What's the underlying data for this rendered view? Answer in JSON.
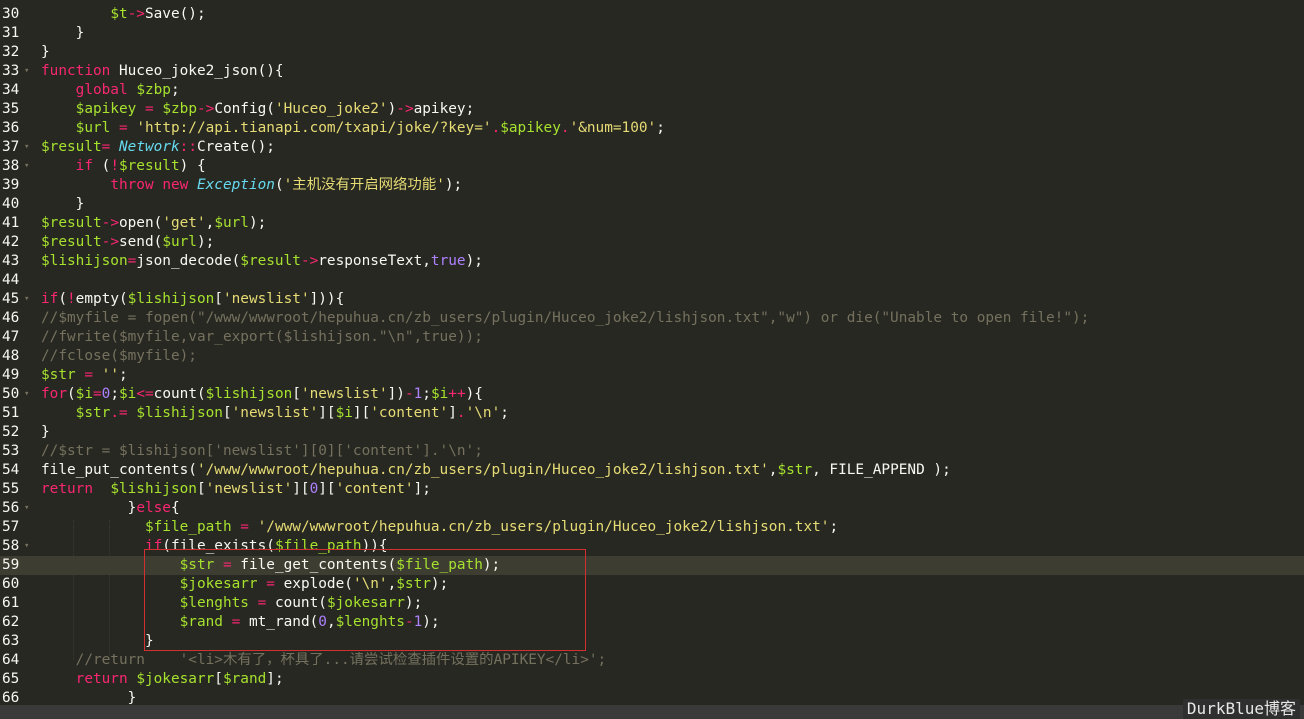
{
  "editor": {
    "theme": "Monokai",
    "colors": {
      "background": "#272822",
      "keyword": "#f92672",
      "variable": "#a6e22e",
      "string": "#e6db74",
      "comment": "#75715e",
      "class": "#66d9ef",
      "constant": "#ae81ff",
      "highlight_box": "#d03030"
    },
    "lines": [
      {
        "n": "30",
        "fold": false,
        "tokens": [
          [
            "p",
            "        "
          ],
          [
            "v",
            "$t"
          ],
          [
            "k",
            "->"
          ],
          [
            "f",
            "Save();"
          ]
        ]
      },
      {
        "n": "31",
        "fold": false,
        "tokens": [
          [
            "p",
            "    }"
          ]
        ]
      },
      {
        "n": "32",
        "fold": false,
        "tokens": [
          [
            "p",
            "}"
          ]
        ]
      },
      {
        "n": "33",
        "fold": true,
        "tokens": [
          [
            "k",
            "function"
          ],
          [
            "p",
            " Huceo_joke2_json(){"
          ]
        ]
      },
      {
        "n": "34",
        "fold": false,
        "tokens": [
          [
            "p",
            "    "
          ],
          [
            "k",
            "global"
          ],
          [
            "p",
            " "
          ],
          [
            "v",
            "$zbp"
          ],
          [
            "p",
            ";"
          ]
        ]
      },
      {
        "n": "35",
        "fold": false,
        "tokens": [
          [
            "p",
            "    "
          ],
          [
            "v",
            "$apikey"
          ],
          [
            "p",
            " "
          ],
          [
            "k",
            "="
          ],
          [
            "p",
            " "
          ],
          [
            "v",
            "$zbp"
          ],
          [
            "k",
            "->"
          ],
          [
            "p",
            "Config("
          ],
          [
            "s",
            "'Huceo_joke2'"
          ],
          [
            "p",
            ")"
          ],
          [
            "k",
            "->"
          ],
          [
            "p",
            "apikey;"
          ]
        ]
      },
      {
        "n": "36",
        "fold": false,
        "tokens": [
          [
            "p",
            "    "
          ],
          [
            "v",
            "$url"
          ],
          [
            "p",
            " "
          ],
          [
            "k",
            "="
          ],
          [
            "p",
            " "
          ],
          [
            "s",
            "'http://api.tianapi.com/txapi/joke/?key='"
          ],
          [
            "k",
            "."
          ],
          [
            "v",
            "$apikey"
          ],
          [
            "k",
            "."
          ],
          [
            "s",
            "'&num=100'"
          ],
          [
            "p",
            ";"
          ]
        ]
      },
      {
        "n": "37",
        "fold": true,
        "tokens": [
          [
            "v",
            "$result"
          ],
          [
            "k",
            "="
          ],
          [
            "p",
            " "
          ],
          [
            "t",
            "Network"
          ],
          [
            "k",
            "::"
          ],
          [
            "p",
            "Create();"
          ]
        ]
      },
      {
        "n": "38",
        "fold": true,
        "tokens": [
          [
            "p",
            "    "
          ],
          [
            "k",
            "if"
          ],
          [
            "p",
            " ("
          ],
          [
            "k",
            "!"
          ],
          [
            "v",
            "$result"
          ],
          [
            "p",
            ") {"
          ]
        ]
      },
      {
        "n": "39",
        "fold": false,
        "tokens": [
          [
            "p",
            "        "
          ],
          [
            "k",
            "throw"
          ],
          [
            "p",
            " "
          ],
          [
            "k",
            "new"
          ],
          [
            "p",
            " "
          ],
          [
            "t",
            "Exception"
          ],
          [
            "p",
            "("
          ],
          [
            "s",
            "'主机没有开启网络功能'"
          ],
          [
            "p",
            ");"
          ]
        ]
      },
      {
        "n": "40",
        "fold": false,
        "tokens": [
          [
            "p",
            "    }"
          ]
        ]
      },
      {
        "n": "41",
        "fold": false,
        "tokens": [
          [
            "v",
            "$result"
          ],
          [
            "k",
            "->"
          ],
          [
            "p",
            "open("
          ],
          [
            "s",
            "'get'"
          ],
          [
            "p",
            ","
          ],
          [
            "v",
            "$url"
          ],
          [
            "p",
            ");"
          ]
        ]
      },
      {
        "n": "42",
        "fold": false,
        "tokens": [
          [
            "v",
            "$result"
          ],
          [
            "k",
            "->"
          ],
          [
            "p",
            "send("
          ],
          [
            "v",
            "$url"
          ],
          [
            "p",
            ");"
          ]
        ]
      },
      {
        "n": "43",
        "fold": false,
        "tokens": [
          [
            "v",
            "$lishijson"
          ],
          [
            "k",
            "="
          ],
          [
            "p",
            "json_decode("
          ],
          [
            "v",
            "$result"
          ],
          [
            "k",
            "->"
          ],
          [
            "p",
            "responseText,"
          ],
          [
            "b",
            "true"
          ],
          [
            "p",
            ");"
          ]
        ]
      },
      {
        "n": "44",
        "fold": false,
        "tokens": []
      },
      {
        "n": "45",
        "fold": true,
        "tokens": [
          [
            "k",
            "if"
          ],
          [
            "p",
            "("
          ],
          [
            "k",
            "!"
          ],
          [
            "p",
            "empty("
          ],
          [
            "v",
            "$lishijson"
          ],
          [
            "p",
            "["
          ],
          [
            "s",
            "'newslist'"
          ],
          [
            "p",
            "])){"
          ]
        ]
      },
      {
        "n": "46",
        "fold": false,
        "tokens": [
          [
            "c",
            "//$myfile = fopen(\"/www/wwwroot/hepuhua.cn/zb_users/plugin/Huceo_joke2/lishjson.txt\",\"w\") or die(\"Unable to open file!\");"
          ]
        ]
      },
      {
        "n": "47",
        "fold": false,
        "tokens": [
          [
            "c",
            "//fwrite($myfile,var_export($lishijson.\"\\n\",true));"
          ]
        ]
      },
      {
        "n": "48",
        "fold": false,
        "tokens": [
          [
            "c",
            "//fclose($myfile);"
          ]
        ]
      },
      {
        "n": "49",
        "fold": false,
        "tokens": [
          [
            "v",
            "$str"
          ],
          [
            "p",
            " "
          ],
          [
            "k",
            "="
          ],
          [
            "p",
            " "
          ],
          [
            "s",
            "''"
          ],
          [
            "p",
            ";"
          ]
        ]
      },
      {
        "n": "50",
        "fold": true,
        "tokens": [
          [
            "k",
            "for"
          ],
          [
            "p",
            "("
          ],
          [
            "v",
            "$i"
          ],
          [
            "k",
            "="
          ],
          [
            "n",
            "0"
          ],
          [
            "p",
            ";"
          ],
          [
            "v",
            "$i"
          ],
          [
            "k",
            "<="
          ],
          [
            "p",
            "count("
          ],
          [
            "v",
            "$lishijson"
          ],
          [
            "p",
            "["
          ],
          [
            "s",
            "'newslist'"
          ],
          [
            "p",
            "])"
          ],
          [
            "k",
            "-"
          ],
          [
            "n",
            "1"
          ],
          [
            "p",
            ";"
          ],
          [
            "v",
            "$i"
          ],
          [
            "k",
            "++"
          ],
          [
            "p",
            "){"
          ]
        ]
      },
      {
        "n": "51",
        "fold": false,
        "tokens": [
          [
            "p",
            "    "
          ],
          [
            "v",
            "$str"
          ],
          [
            "k",
            ".="
          ],
          [
            "p",
            " "
          ],
          [
            "v",
            "$lishijson"
          ],
          [
            "p",
            "["
          ],
          [
            "s",
            "'newslist'"
          ],
          [
            "p",
            "]["
          ],
          [
            "v",
            "$i"
          ],
          [
            "p",
            "]["
          ],
          [
            "s",
            "'content'"
          ],
          [
            "p",
            "]"
          ],
          [
            "k",
            "."
          ],
          [
            "s",
            "'\\n'"
          ],
          [
            "p",
            ";"
          ]
        ]
      },
      {
        "n": "52",
        "fold": false,
        "tokens": [
          [
            "p",
            "}"
          ]
        ]
      },
      {
        "n": "53",
        "fold": false,
        "tokens": [
          [
            "c",
            "//$str = $lishijson['newslist'][0]['content'].'\\n';"
          ]
        ]
      },
      {
        "n": "54",
        "fold": false,
        "tokens": [
          [
            "p",
            "file_put_contents("
          ],
          [
            "s",
            "'/www/wwwroot/hepuhua.cn/zb_users/plugin/Huceo_joke2/lishjson.txt'"
          ],
          [
            "p",
            ","
          ],
          [
            "v",
            "$str"
          ],
          [
            "p",
            ", FILE_APPEND );"
          ]
        ]
      },
      {
        "n": "55",
        "fold": false,
        "tokens": [
          [
            "k",
            "return"
          ],
          [
            "p",
            "  "
          ],
          [
            "v",
            "$lishijson"
          ],
          [
            "p",
            "["
          ],
          [
            "s",
            "'newslist'"
          ],
          [
            "p",
            "]["
          ],
          [
            "n",
            "0"
          ],
          [
            "p",
            "]["
          ],
          [
            "s",
            "'content'"
          ],
          [
            "p",
            "];"
          ]
        ]
      },
      {
        "n": "56",
        "fold": true,
        "tokens": [
          [
            "p",
            "          }"
          ],
          [
            "k",
            "else"
          ],
          [
            "p",
            "{"
          ]
        ]
      },
      {
        "n": "57",
        "fold": false,
        "tokens": [
          [
            "p",
            "            "
          ],
          [
            "v",
            "$file_path"
          ],
          [
            "p",
            " "
          ],
          [
            "k",
            "="
          ],
          [
            "p",
            " "
          ],
          [
            "s",
            "'/www/wwwroot/hepuhua.cn/zb_users/plugin/Huceo_joke2/lishjson.txt'"
          ],
          [
            "p",
            ";"
          ]
        ]
      },
      {
        "n": "58",
        "fold": true,
        "tokens": [
          [
            "p",
            "            "
          ],
          [
            "k",
            "if"
          ],
          [
            "p",
            "(file_exists("
          ],
          [
            "v",
            "$file_path"
          ],
          [
            "p",
            "))"
          ],
          [
            "p",
            "{"
          ]
        ]
      },
      {
        "n": "59",
        "fold": false,
        "current": true,
        "tokens": [
          [
            "p",
            "                "
          ],
          [
            "v",
            "$str"
          ],
          [
            "p",
            " "
          ],
          [
            "k",
            "="
          ],
          [
            "p",
            " file_get_contents("
          ],
          [
            "v",
            "$file_path"
          ],
          [
            "p",
            ");"
          ]
        ]
      },
      {
        "n": "60",
        "fold": false,
        "tokens": [
          [
            "p",
            "                "
          ],
          [
            "v",
            "$jokesarr"
          ],
          [
            "p",
            " "
          ],
          [
            "k",
            "="
          ],
          [
            "p",
            " explode("
          ],
          [
            "s",
            "'\\n'"
          ],
          [
            "p",
            ","
          ],
          [
            "v",
            "$str"
          ],
          [
            "p",
            ");"
          ]
        ]
      },
      {
        "n": "61",
        "fold": false,
        "tokens": [
          [
            "p",
            "                "
          ],
          [
            "v",
            "$lenghts"
          ],
          [
            "p",
            " "
          ],
          [
            "k",
            "="
          ],
          [
            "p",
            " count("
          ],
          [
            "v",
            "$jokesarr"
          ],
          [
            "p",
            ");"
          ]
        ]
      },
      {
        "n": "62",
        "fold": false,
        "tokens": [
          [
            "p",
            "                "
          ],
          [
            "v",
            "$rand"
          ],
          [
            "p",
            " "
          ],
          [
            "k",
            "="
          ],
          [
            "p",
            " mt_rand("
          ],
          [
            "n",
            "0"
          ],
          [
            "p",
            ","
          ],
          [
            "v",
            "$lenghts"
          ],
          [
            "k",
            "-"
          ],
          [
            "n",
            "1"
          ],
          [
            "p",
            ");"
          ]
        ]
      },
      {
        "n": "63",
        "fold": false,
        "tokens": [
          [
            "p",
            "            }"
          ]
        ]
      },
      {
        "n": "64",
        "fold": false,
        "tokens": [
          [
            "p",
            "    "
          ],
          [
            "c",
            "//return    '<li>木有了，杯具了...请尝试检查插件设置的APIKEY</li>';"
          ]
        ]
      },
      {
        "n": "65",
        "fold": false,
        "tokens": [
          [
            "p",
            "    "
          ],
          [
            "k",
            "return"
          ],
          [
            "p",
            " "
          ],
          [
            "v",
            "$jokesarr"
          ],
          [
            "p",
            "["
          ],
          [
            "v",
            "$rand"
          ],
          [
            "p",
            "];"
          ]
        ]
      },
      {
        "n": "66",
        "fold": false,
        "tokens": [
          [
            "p",
            "          }"
          ]
        ]
      }
    ]
  },
  "watermark": {
    "text": "DurkBlue博客"
  }
}
